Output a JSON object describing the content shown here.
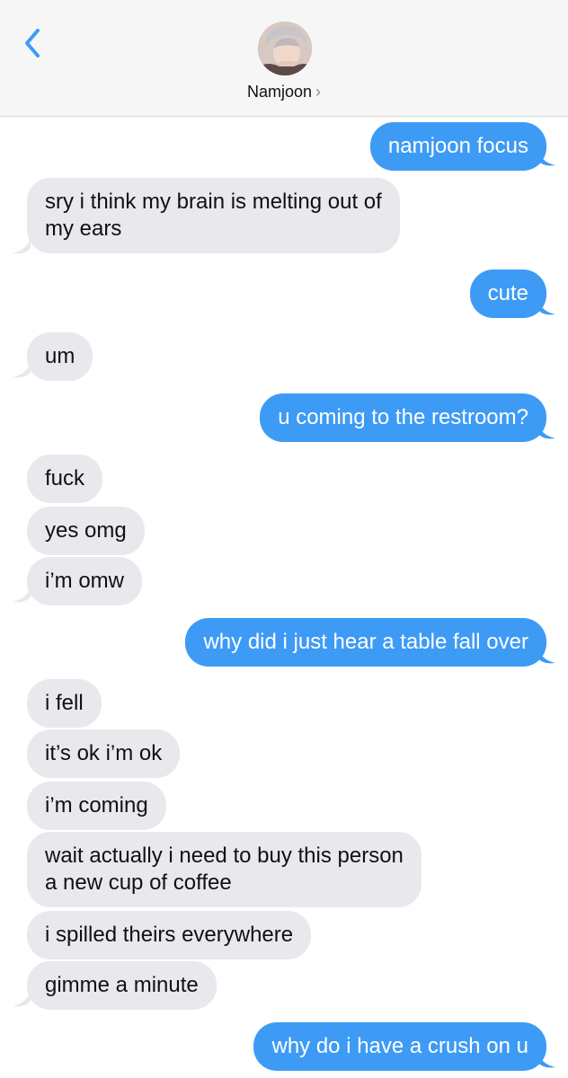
{
  "header": {
    "contact_name": "Namjoon",
    "chevron": "›",
    "back_icon": "chevron-left-icon",
    "accent_color": "#3d9bf5"
  },
  "colors": {
    "outgoing_bubble": "#3d9bf5",
    "incoming_bubble": "#e8e8ed"
  },
  "messages": [
    {
      "direction": "outgoing",
      "text": "namjoon focus"
    },
    {
      "direction": "incoming",
      "lines": [
        "sry i think my brain is melting out of",
        "my ears"
      ]
    },
    {
      "direction": "outgoing",
      "text": "cute"
    },
    {
      "direction": "incoming",
      "text": "um"
    },
    {
      "direction": "outgoing",
      "text": "u coming to the restroom?"
    },
    {
      "direction": "incoming",
      "text": "fuck"
    },
    {
      "direction": "incoming",
      "text": "yes omg"
    },
    {
      "direction": "incoming",
      "text": "i’m omw"
    },
    {
      "direction": "outgoing",
      "text": "why did i just hear a table fall over"
    },
    {
      "direction": "incoming",
      "text": "i fell"
    },
    {
      "direction": "incoming",
      "text": "it’s ok i’m ok"
    },
    {
      "direction": "incoming",
      "text": "i’m coming"
    },
    {
      "direction": "incoming",
      "lines": [
        "wait actually i need to buy this person",
        "a new cup of coffee"
      ]
    },
    {
      "direction": "incoming",
      "text": "i spilled theirs everywhere"
    },
    {
      "direction": "incoming",
      "text": "gimme a minute"
    },
    {
      "direction": "outgoing",
      "text": "why do i have a crush on u"
    }
  ]
}
